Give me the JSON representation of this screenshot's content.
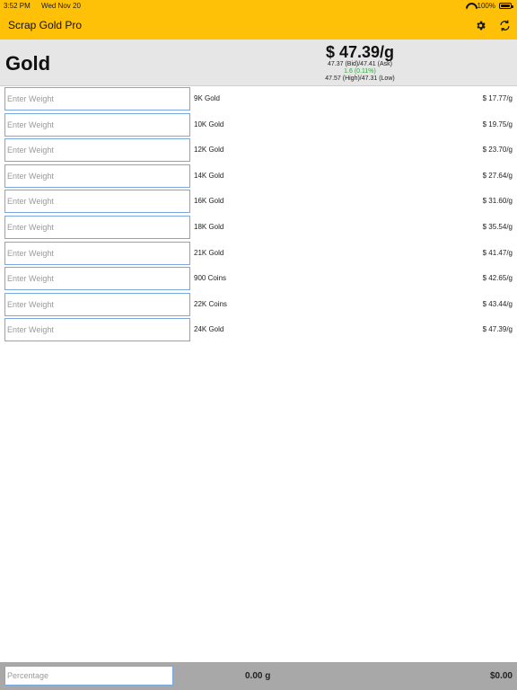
{
  "status_bar": {
    "time": "3:52 PM",
    "date": "Wed Nov 20",
    "battery": "100%"
  },
  "nav": {
    "title": "Scrap Gold Pro",
    "settings_icon": "gear-icon",
    "refresh_icon": "refresh-icon"
  },
  "header": {
    "metal": "Gold",
    "price": "$ 47.39/g",
    "bid_ask": "47.37 (Bid)/47.41 (Ask)",
    "change": "1.6 (0.11%)",
    "high_low": "47.57 (High)/47.31 (Low)",
    "change_color": "#2eaa3a"
  },
  "rows": [
    {
      "placeholder": "Enter Weight",
      "label": "9K Gold",
      "price": "$ 17.77/g"
    },
    {
      "placeholder": "Enter Weight",
      "label": "10K Gold",
      "price": "$ 19.75/g"
    },
    {
      "placeholder": "Enter Weight",
      "label": "12K Gold",
      "price": "$ 23.70/g"
    },
    {
      "placeholder": "Enter Weight",
      "label": "14K Gold",
      "price": "$ 27.64/g"
    },
    {
      "placeholder": "Enter Weight",
      "label": "16K Gold",
      "price": "$ 31.60/g"
    },
    {
      "placeholder": "Enter Weight",
      "label": "18K Gold",
      "price": "$ 35.54/g"
    },
    {
      "placeholder": "Enter Weight",
      "label": "21K Gold",
      "price": "$ 41.47/g"
    },
    {
      "placeholder": "Enter Weight",
      "label": "900 Coins",
      "price": "$ 42.65/g"
    },
    {
      "placeholder": "Enter Weight",
      "label": "22K Coins",
      "price": "$ 43.44/g"
    },
    {
      "placeholder": "Enter Weight",
      "label": "24K Gold",
      "price": "$ 47.39/g"
    }
  ],
  "footer": {
    "percent_placeholder": "Percentage",
    "total_weight": "0.00 g",
    "total_value": "$0.00"
  },
  "colors": {
    "nav_background": "#FFC107",
    "header_background": "#e6e6e6",
    "input_border": "#7aa7e0",
    "footer_background": "#a8a8a8"
  }
}
